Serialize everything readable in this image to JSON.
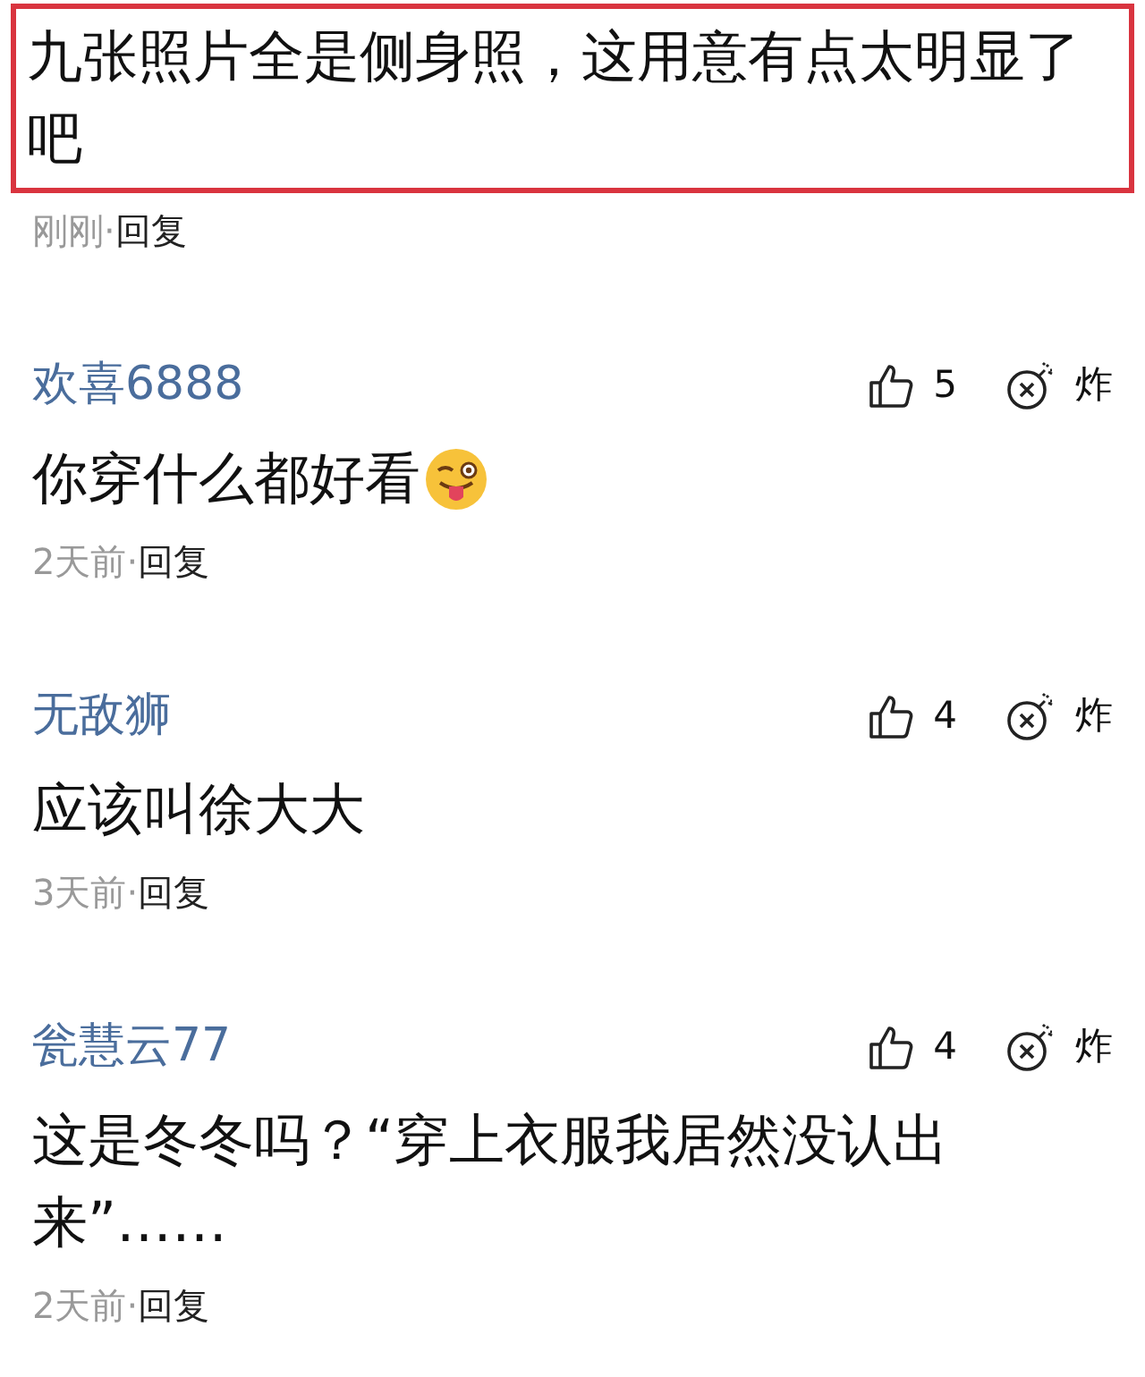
{
  "comments": [
    {
      "highlighted": true,
      "text": "九张照片全是侧身照，这用意有点太明显了吧",
      "time": "刚刚",
      "separator": "·",
      "reply": "回复"
    },
    {
      "highlighted": false,
      "user": "欢喜6888",
      "likes": "5",
      "bomb": "炸",
      "text": "你穿什么都好看",
      "emoji": true,
      "time": "2天前",
      "separator": "·",
      "reply": "回复"
    },
    {
      "highlighted": false,
      "user": "无敌狮",
      "likes": "4",
      "bomb": "炸",
      "text": "应该叫徐大大",
      "emoji": false,
      "time": "3天前",
      "separator": "·",
      "reply": "回复"
    },
    {
      "highlighted": false,
      "user": "瓮慧云77",
      "likes": "4",
      "bomb": "炸",
      "text": "这是冬冬吗？“穿上衣服我居然没认出来”……",
      "emoji": false,
      "time": "2天前",
      "separator": "·",
      "reply": "回复"
    }
  ]
}
